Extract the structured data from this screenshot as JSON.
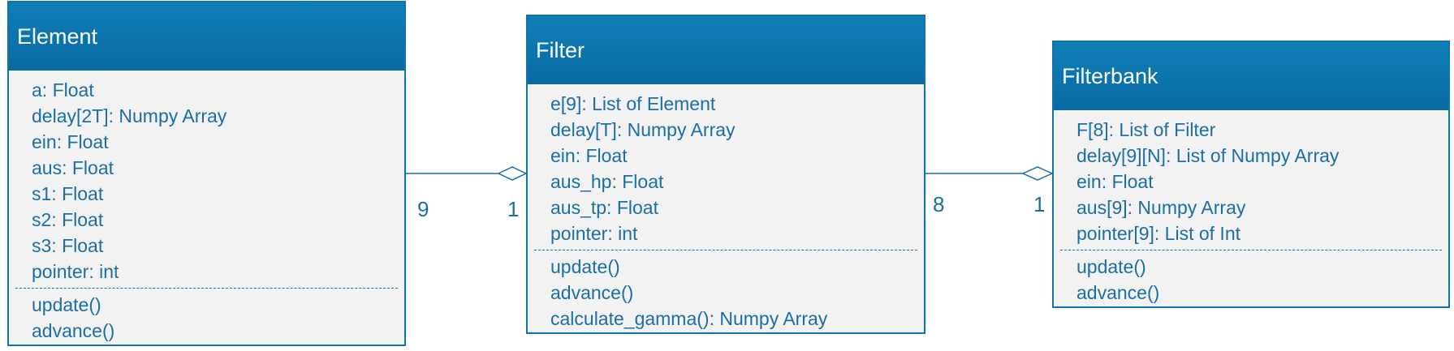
{
  "classes": [
    {
      "name": "Element",
      "attributes": [
        "a: Float",
        "delay[2T]: Numpy Array",
        "ein: Float",
        "aus: Float",
        "s1: Float",
        "s2: Float",
        "s3: Float",
        "pointer: int"
      ],
      "methods": [
        "update()",
        "advance()"
      ]
    },
    {
      "name": "Filter",
      "attributes": [
        "e[9]: List of Element",
        "delay[T]: Numpy Array",
        "ein: Float",
        "aus_hp: Float",
        "aus_tp: Float",
        "pointer: int"
      ],
      "methods": [
        "update()",
        "advance()",
        "calculate_gamma(): Numpy Array"
      ]
    },
    {
      "name": "Filterbank",
      "attributes": [
        "F[8]: List of Filter",
        "delay[9][N]: List of Numpy Array",
        "ein: Float",
        "aus[9]: Numpy Array",
        "pointer[9]: List of Int"
      ],
      "methods": [
        "update()",
        "advance()"
      ]
    }
  ],
  "associations": [
    {
      "from": "Element",
      "to": "Filter",
      "kind": "aggregation",
      "from_multiplicity": "9",
      "to_multiplicity": "1"
    },
    {
      "from": "Filter",
      "to": "Filterbank",
      "kind": "aggregation",
      "from_multiplicity": "8",
      "to_multiplicity": "1"
    }
  ],
  "colors": {
    "header": "#0f74ad",
    "text": "#1b6fa5",
    "body": "#f2f2f2",
    "border": "#0f74ad"
  }
}
